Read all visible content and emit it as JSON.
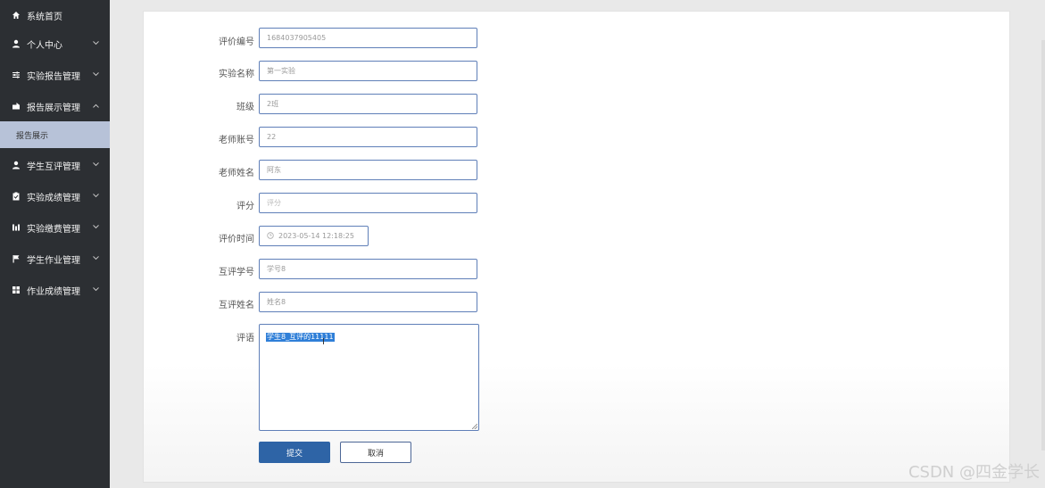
{
  "sidebar": {
    "items": [
      {
        "label": "系统首页",
        "icon": "home-icon",
        "expanded": null
      },
      {
        "label": "个人中心",
        "icon": "user-icon",
        "expanded": false
      },
      {
        "label": "实验报告管理",
        "icon": "sliders-icon",
        "expanded": false
      },
      {
        "label": "报告展示管理",
        "icon": "briefcase-icon",
        "expanded": true
      },
      {
        "label": "学生互评管理",
        "icon": "user-icon",
        "expanded": false
      },
      {
        "label": "实验成绩管理",
        "icon": "clipboard-icon",
        "expanded": false
      },
      {
        "label": "实验缴费管理",
        "icon": "bar-chart-icon",
        "expanded": false
      },
      {
        "label": "学生作业管理",
        "icon": "flag-icon",
        "expanded": false
      },
      {
        "label": "作业成绩管理",
        "icon": "grid-icon",
        "expanded": false
      }
    ],
    "active_sub_item": "报告展示"
  },
  "form": {
    "fields": [
      {
        "label": "评价编号",
        "value": "1684037905405"
      },
      {
        "label": "实验名称",
        "value": "第一实验"
      },
      {
        "label": "班级",
        "value": "2班"
      },
      {
        "label": "老师账号",
        "value": "22"
      },
      {
        "label": "老师姓名",
        "value": "阿东"
      },
      {
        "label": "评分",
        "placeholder": "评分"
      },
      {
        "label": "评价时间",
        "value": "2023-05-14 12:18:25"
      },
      {
        "label": "互评学号",
        "value": "学号8"
      },
      {
        "label": "互评姓名",
        "value": "姓名8"
      }
    ],
    "comment_label": "评语",
    "comment_value": "学生8_互评的11111",
    "submit_label": "提交",
    "cancel_label": "取消"
  },
  "watermark": "CSDN @四金学长",
  "colors": {
    "sidebar_bg": "#2c2f33",
    "active_sub_bg": "#b7c2d8",
    "primary": "#2e64a6",
    "field_border": "#5f7fb8",
    "selection": "#2f7fd8"
  }
}
